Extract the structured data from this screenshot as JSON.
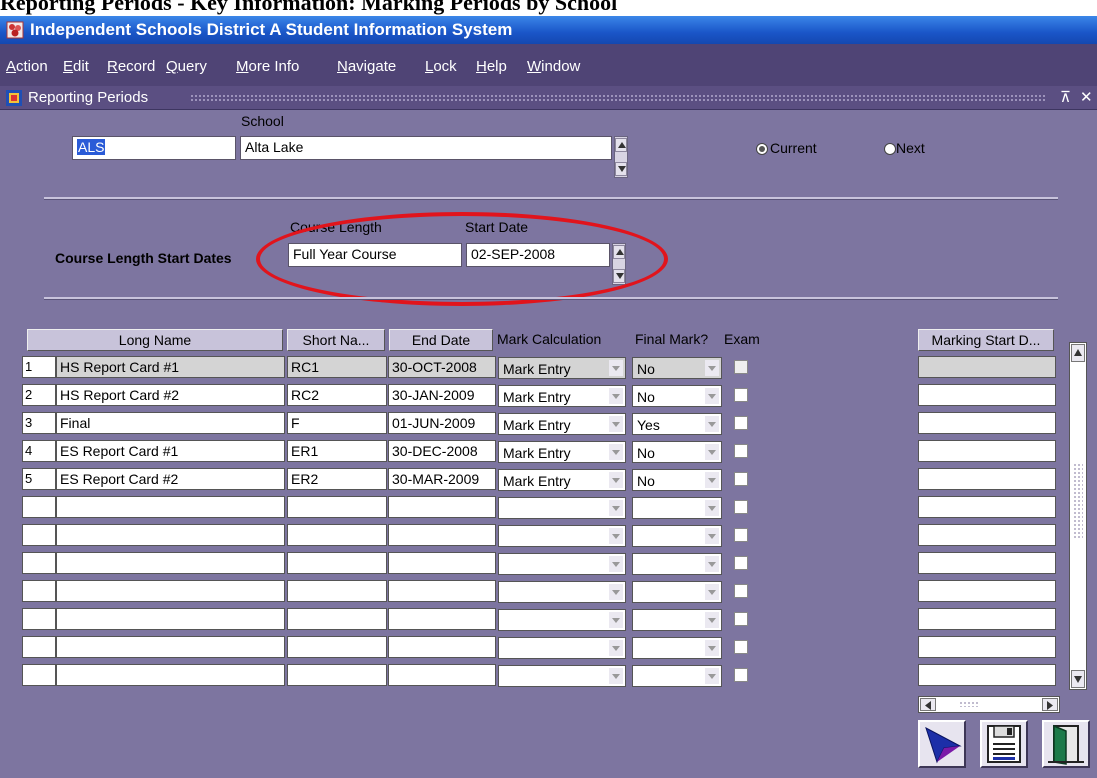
{
  "doc_heading": "Reporting Periods - Key Information: Marking Periods by School",
  "window": {
    "title": "Independent Schools District A Student Information System"
  },
  "menu": [
    "Action",
    "Edit",
    "Record",
    "Query",
    "More Info",
    "Navigate",
    "Lock",
    "Help",
    "Window"
  ],
  "form": {
    "title": "Reporting Periods",
    "restore_glyph": "⊼",
    "close_glyph": "✕"
  },
  "school": {
    "label": "School",
    "code": "ALS",
    "name": "Alta Lake"
  },
  "period_radio": {
    "current": "Current",
    "next": "Next",
    "selected": "current"
  },
  "course_length": {
    "section_label": "Course Length Start Dates",
    "col_course_length": "Course Length",
    "col_start_date": "Start Date",
    "course_length_value": "Full Year Course",
    "start_date_value": "02-SEP-2008"
  },
  "table": {
    "headers": {
      "long_name": "Long Name",
      "short_name": "Short Na...",
      "end_date": "End Date",
      "mark_calc": "Mark Calculation",
      "final_mark": "Final Mark?",
      "exam": "Exam",
      "marking_start": "Marking Start D..."
    },
    "rows": [
      {
        "num": "1",
        "long_name": "HS Report Card #1",
        "short_name": "RC1",
        "end_date": "30-OCT-2008",
        "mark_calc": "Mark Entry",
        "final_mark": "No"
      },
      {
        "num": "2",
        "long_name": "HS Report Card #2",
        "short_name": "RC2",
        "end_date": "30-JAN-2009",
        "mark_calc": "Mark Entry",
        "final_mark": "No"
      },
      {
        "num": "3",
        "long_name": "Final",
        "short_name": "F",
        "end_date": "01-JUN-2009",
        "mark_calc": "Mark Entry",
        "final_mark": "Yes"
      },
      {
        "num": "4",
        "long_name": "ES Report Card #1",
        "short_name": "ER1",
        "end_date": "30-DEC-2008",
        "mark_calc": "Mark Entry",
        "final_mark": "No"
      },
      {
        "num": "5",
        "long_name": "ES Report Card #2",
        "short_name": "ER2",
        "end_date": "30-MAR-2009",
        "mark_calc": "Mark Entry",
        "final_mark": "No"
      }
    ],
    "empty_rows": 7
  },
  "toolbar": {
    "icons": [
      "pointer-icon",
      "save-icon",
      "exit-door-icon"
    ]
  },
  "colors": {
    "titlebar": "#1a55c8",
    "menubar": "#4f4475",
    "canvas": "#7d75a0",
    "annotation": "#e1141c"
  }
}
